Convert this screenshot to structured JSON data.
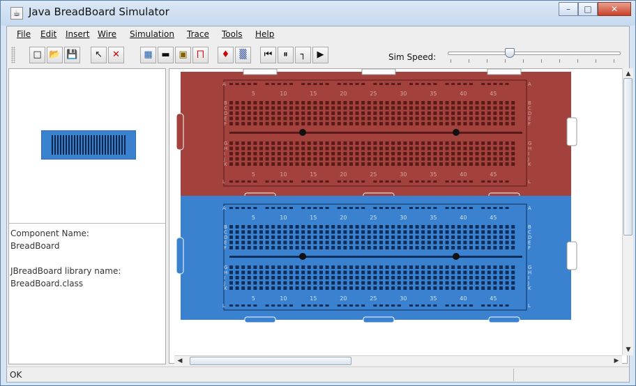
{
  "window": {
    "title": "Java BreadBoard Simulator"
  },
  "title_controls": [
    {
      "name": "minimize-button",
      "glyph": "–"
    },
    {
      "name": "maximize-button",
      "glyph": "□"
    },
    {
      "name": "close-button",
      "glyph": "✕"
    }
  ],
  "menu": [
    "File",
    "Edit",
    "Insert",
    "Wire",
    "Simulation",
    "Trace",
    "Tools",
    "Help"
  ],
  "toolbar": {
    "buttons": [
      {
        "icon": "new-file-icon",
        "glyph": "□"
      },
      {
        "icon": "open-folder-icon",
        "glyph": "📂"
      },
      {
        "icon": "save-icon",
        "glyph": "💾"
      },
      {
        "icon": "select-pointer-icon",
        "glyph": "↖"
      },
      {
        "icon": "delete-icon",
        "glyph": "✕"
      },
      {
        "icon": "breadboard-icon",
        "glyph": "▦"
      },
      {
        "icon": "chip-icon",
        "glyph": "▬"
      },
      {
        "icon": "display-chip-icon",
        "glyph": "▣"
      },
      {
        "icon": "wire-icon",
        "glyph": "⨅"
      },
      {
        "icon": "probe-icon",
        "glyph": "♦"
      },
      {
        "icon": "dip-switch-icon",
        "glyph": "▒"
      },
      {
        "icon": "rewind-icon",
        "glyph": "⏮"
      },
      {
        "icon": "pause-icon",
        "glyph": "⏸"
      },
      {
        "icon": "step-icon",
        "glyph": "┐"
      },
      {
        "icon": "play-icon",
        "glyph": "▶"
      }
    ],
    "sim_speed_label": "Sim Speed:",
    "sim_speed_level": 0.35
  },
  "info": {
    "component_name_label": "Component Name:",
    "component_name_value": "BreadBoard",
    "library_label": "JBreadBoard library name:",
    "library_value": "BreadBoard.class"
  },
  "breadboards": [
    {
      "color": "#a3413c",
      "dark": "#5a1a17",
      "label_color": "#d8a5a2"
    },
    {
      "color": "#3a82cf",
      "dark": "#0f2d5a",
      "label_color": "#cfe2f7"
    }
  ],
  "column_numbers": [
    "5",
    "10",
    "15",
    "20",
    "25",
    "30",
    "35",
    "40",
    "45"
  ],
  "row_labels_top": [
    "A",
    "B",
    "C",
    "D",
    "E",
    "F"
  ],
  "row_labels_bottom": [
    "G",
    "H",
    "I",
    "J",
    "K",
    "L"
  ],
  "status": {
    "text": "OK"
  }
}
